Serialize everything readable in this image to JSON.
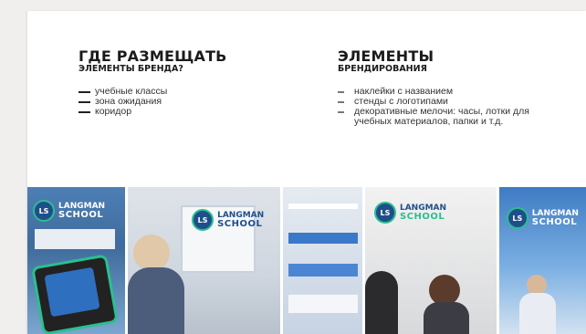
{
  "left_section": {
    "title": "ГДЕ РАЗМЕЩАТЬ",
    "subtitle": "ЭЛЕМЕНТЫ БРЕНДА?",
    "items": [
      "учебные классы",
      "зона ожидания",
      "коридор"
    ]
  },
  "right_section": {
    "title": "ЭЛЕМЕНТЫ",
    "subtitle": "БРЕНДИРОВАНИЯ",
    "items": [
      "наклейки с названием",
      "стенды с логотипами",
      "декоративные мелочи: часы, лотки для учебных материалов, папки и т.д."
    ]
  },
  "brand": {
    "logo_mark": "LS",
    "logo_top": "LANGMAN",
    "logo_bottom": "SCHOOL"
  },
  "colors": {
    "brand_blue": "#1f4f8a",
    "brand_teal": "#2bbf8f"
  }
}
